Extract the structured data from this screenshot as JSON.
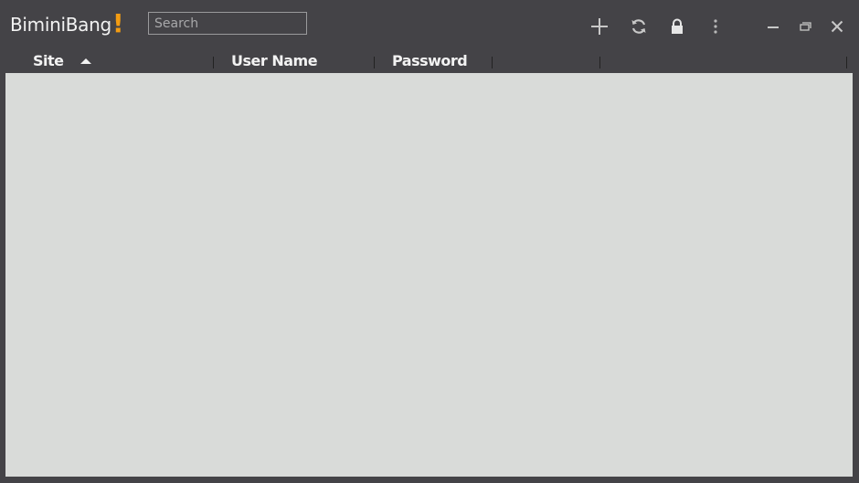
{
  "app": {
    "name": "BiminiBang",
    "name_accent": "!",
    "accent_color": "#f39c12"
  },
  "search": {
    "placeholder": "Search",
    "value": ""
  },
  "toolbar": {
    "icons": [
      "plus-icon",
      "refresh-icon",
      "lock-icon",
      "more-vertical-icon"
    ]
  },
  "window_controls": [
    "minimize",
    "restore",
    "close"
  ],
  "table": {
    "columns": [
      {
        "label": "Site",
        "sort": "ascending"
      },
      {
        "label": "User Name"
      },
      {
        "label": "Password"
      },
      {
        "label": ""
      },
      {
        "label": ""
      }
    ],
    "rows": []
  }
}
